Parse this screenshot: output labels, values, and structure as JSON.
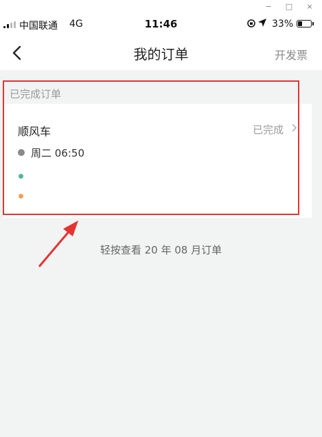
{
  "window_controls": {
    "minimize": "−",
    "maximize": "□",
    "close": "×"
  },
  "status_bar": {
    "carrier": "中国联通",
    "network": "4G",
    "time": "11:46",
    "battery": "33%",
    "battery_level": 0.33,
    "orientation_icon": "rotation-lock-icon",
    "location_icon": "location-arrow-icon"
  },
  "nav": {
    "title": "我的订单",
    "invoice": "开发票",
    "back_icon": "chevron-left-icon"
  },
  "section": {
    "title": "已完成订单"
  },
  "order": {
    "type": "顺风车",
    "status": "已完成",
    "time": "周二 06:50"
  },
  "footer": {
    "month_link": "轻按查看 20 年 08 月订单"
  },
  "colors": {
    "highlight": "#e53232",
    "start_dot": "#4db89a",
    "end_dot": "#f0a05a"
  }
}
